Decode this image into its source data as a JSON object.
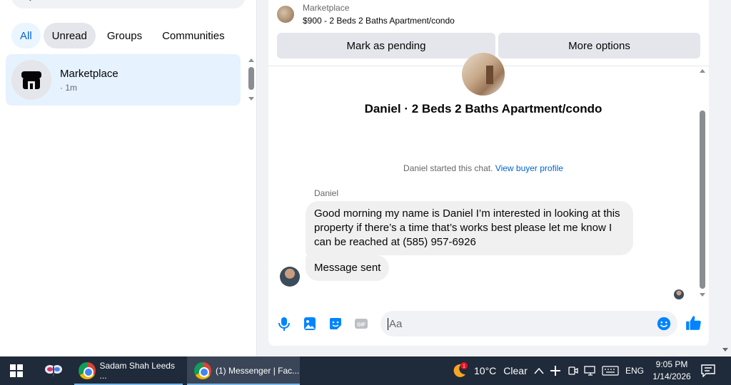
{
  "sidebar": {
    "search_placeholder": "Search Messenger",
    "filters": [
      {
        "label": "All"
      },
      {
        "label": "Unread"
      },
      {
        "label": "Groups"
      },
      {
        "label": "Communities"
      }
    ],
    "conversation": {
      "name": "Marketplace",
      "time": "· 1m"
    }
  },
  "chat": {
    "header_label": "Marketplace",
    "header_title": "$900 - 2 Beds 2 Baths Apartment/condo",
    "mark_pending_label": "Mark as pending",
    "more_options_label": "More options",
    "chat_title": "Daniel · 2 Beds 2 Baths Apartment/condo",
    "started_text": "Daniel started this chat.",
    "buyer_profile_link": "View buyer profile",
    "sender_name": "Daniel",
    "messages": [
      "Good morning my name is Daniel I’m interested in looking at this property if there’s a time that’s works best please let me know I can be reached at (585) 957-6926",
      "Message sent"
    ],
    "composer_placeholder": "Aa",
    "accent_color": "#0084ff"
  },
  "taskbar": {
    "items": [
      {
        "label": "Sadam Shah Leeds ..."
      },
      {
        "label": "(1) Messenger | Fac..."
      }
    ],
    "weather": {
      "temp": "10°C",
      "condition": "Clear",
      "badge": "1"
    },
    "language": "ENG",
    "time": "9:05 PM",
    "date": "1/14/2026"
  }
}
